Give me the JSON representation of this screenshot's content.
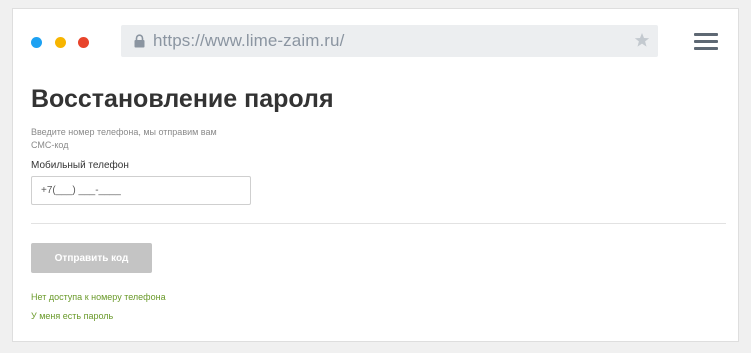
{
  "browser": {
    "url": "https://www.lime-zaim.ru/",
    "dot_colors": [
      "#1da1f2",
      "#f7b500",
      "#e8442b"
    ],
    "icons": [
      "lock-icon",
      "star-icon",
      "hamburger-menu-icon"
    ]
  },
  "page": {
    "title": "Восстановление пароля",
    "hint": "Введите номер телефона, мы отправим вам СМС-код",
    "phone_label": "Мобильный телефон",
    "phone_placeholder": "+7(___) ___-____",
    "phone_value": "",
    "submit_label": "Отправить код",
    "submit_color": "#c4c4c4",
    "links": {
      "no_access": "Нет доступа к номеру телефона",
      "have_password": "У меня есть пароль"
    },
    "link_color": "#6a9a2a"
  }
}
